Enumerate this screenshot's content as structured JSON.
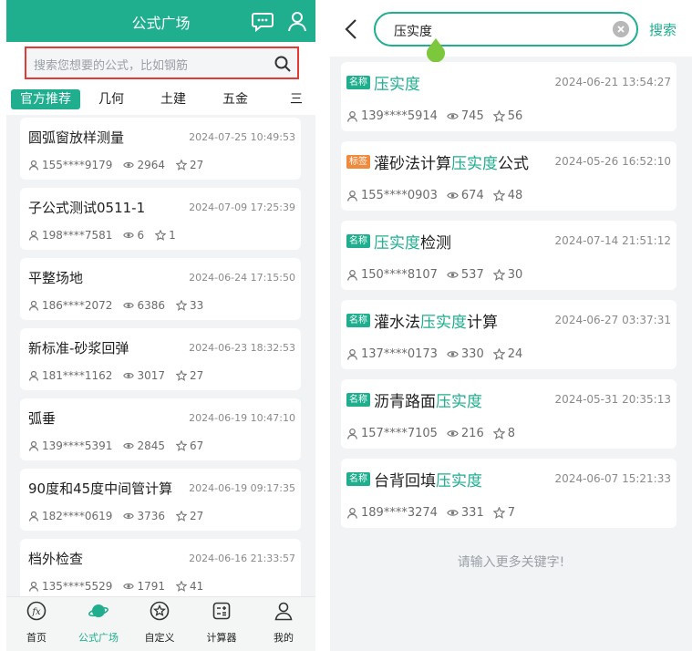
{
  "left": {
    "header_title": "公式广场",
    "search_placeholder": "搜索您想要的公式，比如钢筋",
    "tabs": [
      "官方推荐",
      "几何",
      "土建",
      "五金",
      "三"
    ],
    "cards": [
      {
        "name": "圆弧窗放样测量",
        "date": "2024-07-25 10:49:53",
        "user": "155****9179",
        "views": "2964",
        "stars": "27"
      },
      {
        "name": "子公式测试0511-1",
        "date": "2024-07-09 17:25:39",
        "user": "198****7581",
        "views": "6",
        "stars": "1"
      },
      {
        "name": "平整场地",
        "date": "2024-06-24 17:15:50",
        "user": "186****2072",
        "views": "6386",
        "stars": "33"
      },
      {
        "name": "新标准-砂浆回弹",
        "date": "2024-06-23 18:32:53",
        "user": "181****1162",
        "views": "3017",
        "stars": "27"
      },
      {
        "name": "弧垂",
        "date": "2024-06-19 10:47:10",
        "user": "139****5391",
        "views": "2845",
        "stars": "67"
      },
      {
        "name": "90度和45度中间管计算",
        "date": "2024-06-19 09:17:35",
        "user": "182****0619",
        "views": "3736",
        "stars": "27"
      },
      {
        "name": "档外检查",
        "date": "2024-06-16 21:33:57",
        "user": "135****5529",
        "views": "1791",
        "stars": "41"
      }
    ],
    "nav": [
      "首页",
      "公式广场",
      "自定义",
      "计算器",
      "我的"
    ]
  },
  "right": {
    "search_value": "压实度",
    "search_button": "搜索",
    "cards": [
      {
        "badge": "名称",
        "badge_type": "name",
        "pre": "",
        "hl": "压实度",
        "post": "",
        "date": "2024-06-21 13:54:27",
        "user": "139****5914",
        "views": "745",
        "stars": "56"
      },
      {
        "badge": "标签",
        "badge_type": "tag",
        "pre": "灌砂法计算",
        "hl": "压实度",
        "post": "公式",
        "date": "2024-05-26 16:52:10",
        "user": "155****0903",
        "views": "674",
        "stars": "48"
      },
      {
        "badge": "名称",
        "badge_type": "name",
        "pre": "",
        "hl": "压实度",
        "post": "检测",
        "date": "2024-07-14 21:51:12",
        "user": "150****8107",
        "views": "537",
        "stars": "30"
      },
      {
        "badge": "名称",
        "badge_type": "name",
        "pre": "灌水法",
        "hl": "压实度",
        "post": "计算",
        "date": "2024-06-27 03:37:31",
        "user": "137****0173",
        "views": "330",
        "stars": "24"
      },
      {
        "badge": "名称",
        "badge_type": "name",
        "pre": "沥青路面",
        "hl": "压实度",
        "post": "",
        "date": "2024-05-31 20:35:13",
        "user": "157****7105",
        "views": "216",
        "stars": "8"
      },
      {
        "badge": "名称",
        "badge_type": "name",
        "pre": "台背回填",
        "hl": "压实度",
        "post": "",
        "date": "2024-06-07 15:21:33",
        "user": "189****3274",
        "views": "331",
        "stars": "7"
      }
    ],
    "footer_hint": "请输入更多关键字!"
  },
  "colors": {
    "accent": "#1fae8e",
    "tag": "#f08a3c",
    "highlight_border": "#e53935"
  }
}
